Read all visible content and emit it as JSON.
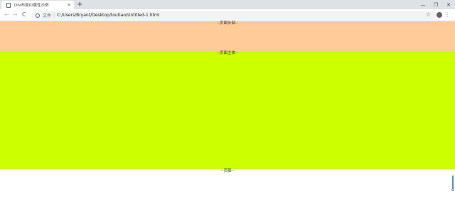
{
  "browser": {
    "tab_title": "DIV布局ID属性示例",
    "tab_close": "×",
    "new_tab": "+",
    "window_controls": {
      "minimize": "—",
      "maximize": "❐",
      "close": "✕"
    },
    "nav": {
      "back": "←",
      "forward": "→",
      "reload": "C"
    },
    "omnibox": {
      "scheme_label": "文件",
      "separator": "|",
      "url": "C:/Users/Bryant/Desktop/toutiao/Untitled-1.html"
    },
    "icons": {
      "star": "☆",
      "menu": "⋮"
    }
  },
  "page": {
    "header_label": "--页面头部--",
    "main_label": "--页面主体--",
    "footer_label": "--页脚--"
  },
  "colors": {
    "header_bg": "#ffcc99",
    "main_bg": "#ccff00",
    "footer_bg": "#ffffff"
  }
}
